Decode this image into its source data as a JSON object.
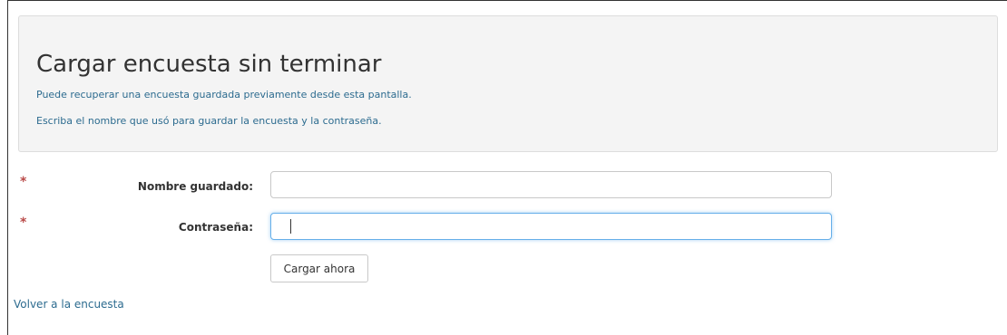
{
  "header": {
    "title": "Cargar encuesta sin terminar",
    "line1": "Puede recuperar una encuesta guardada previamente desde esta pantalla.",
    "line2": "Escriba el nombre que usó para guardar la encuesta y la contraseña."
  },
  "form": {
    "required_mark": "*",
    "name_label": "Nombre guardado:",
    "name_value": "",
    "password_label": "Contraseña:",
    "password_value": "",
    "submit_label": "Cargar ahora"
  },
  "footer": {
    "back_link": "Volver a la encuesta"
  },
  "colors": {
    "link": "#2c6b8f",
    "required": "#b94a48",
    "focus": "#66afe9",
    "panel": "#f4f4f4"
  }
}
